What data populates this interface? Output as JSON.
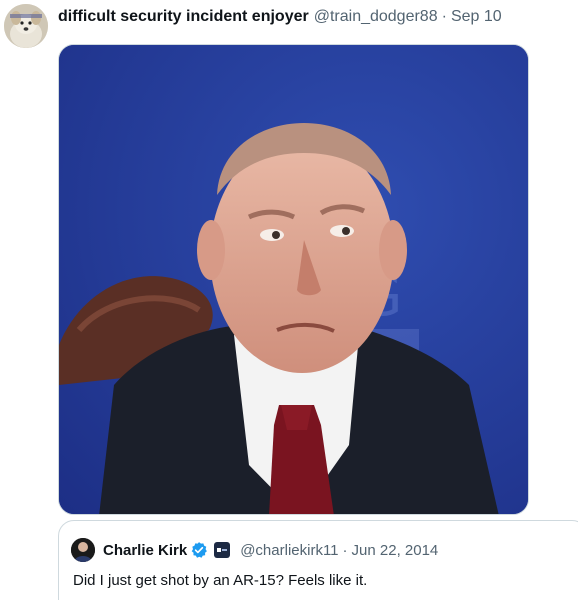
{
  "tweet": {
    "display_name": "difficult security incident enjoyer",
    "handle": "@train_dodger88",
    "separator": "·",
    "date": "Sep 10",
    "avatar_icon": "dog-avatar",
    "media": {
      "icon": "photo-man-in-suit",
      "background_color": "#233a95"
    }
  },
  "quoted_tweet": {
    "display_name": "Charlie Kirk",
    "verified_icon": "verified-badge-icon",
    "verified_color": "#1d9bf0",
    "affiliation_icon": "affiliation-badge-icon",
    "handle": "@charliekirk11",
    "separator": "·",
    "date": "Jun 22, 2014",
    "text": "Did I just get shot by an AR-15? Feels like it."
  }
}
